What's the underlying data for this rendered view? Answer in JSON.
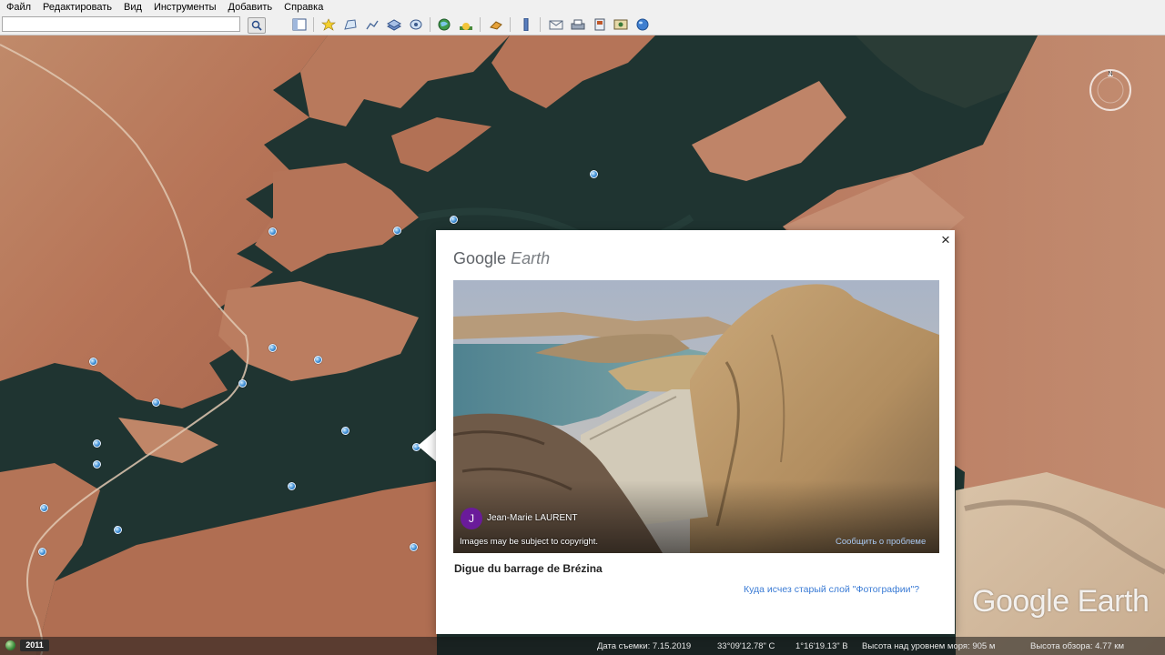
{
  "menu": {
    "items": [
      {
        "label": "Файл"
      },
      {
        "label": "Редактировать"
      },
      {
        "label": "Вид"
      },
      {
        "label": "Инструменты"
      },
      {
        "label": "Добавить"
      },
      {
        "label": "Справка"
      }
    ]
  },
  "toolbar": {
    "search_value": "",
    "icons": [
      "search-icon",
      "sidebar-toggle-icon",
      "placemark-icon",
      "polygon-icon",
      "path-icon",
      "image-overlay-icon",
      "tour-icon",
      "historical-imagery-icon",
      "sun-icon",
      "planet-icon",
      "ruler-icon",
      "email-icon",
      "print-icon",
      "save-image-icon",
      "map-view-icon",
      "globe-icon"
    ]
  },
  "popup": {
    "logo_brand": "Google",
    "logo_product": "Earth",
    "close_label": "×",
    "author_initial": "J",
    "author_name": "Jean-Marie LAURENT",
    "copyright_note": "Images may be subject to copyright.",
    "report_link": "Сообщить о проблеме",
    "place_title": "Digue du barrage de Brézina",
    "layer_link": "Куда исчез старый слой \"Фотографии\"?"
  },
  "watermark": {
    "brand": "Google",
    "product": "Earth"
  },
  "status": {
    "year": "2011",
    "capture_date": "Дата съемки: 7.15.2019",
    "latitude": "33°09'12.78\" С",
    "longitude": "1°16'19.13\" В",
    "elevation": "Высота над уровнем моря:   905 м",
    "eye_altitude": "Высота обзора:  4.77 км"
  },
  "colors": {
    "menubar_bg": "#f0f0f0",
    "water": "#1f3431",
    "terrain": "#b87a5e",
    "link_blue": "#3a7bd5"
  }
}
